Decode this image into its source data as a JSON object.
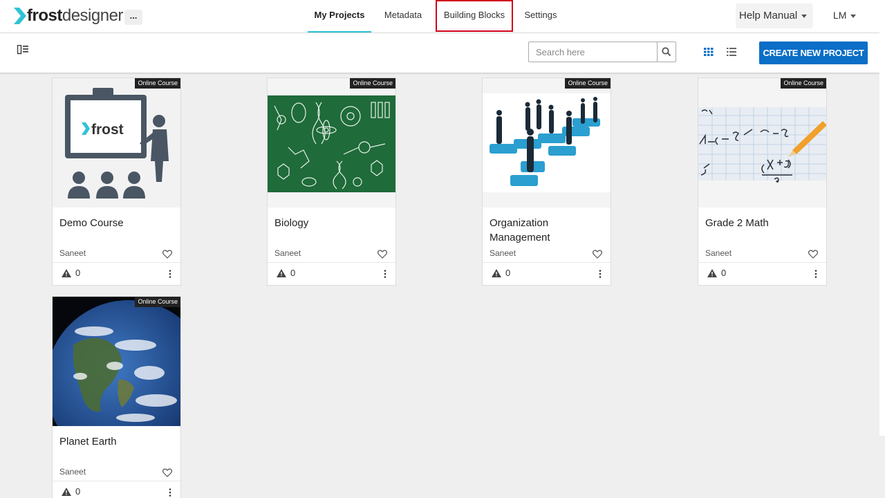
{
  "brand": {
    "bold": "frost",
    "light": "designer",
    "accent": "#2ec3d6"
  },
  "nav": {
    "more_label": "...",
    "tabs": [
      {
        "label": "My Projects",
        "active": true
      },
      {
        "label": "Metadata"
      },
      {
        "label": "Building Blocks",
        "highlighted": true
      },
      {
        "label": "Settings"
      }
    ],
    "help_label": "Help Manual",
    "user_initials": "LM"
  },
  "toolbar": {
    "search_placeholder": "Search here",
    "create_label": "CREATE NEW PROJECT",
    "create_color": "#0b6ec7"
  },
  "projects": [
    {
      "title": "Demo Course",
      "badge": "Online Course",
      "author": "Saneet",
      "warnings": "0",
      "thumb_text": "frost",
      "thumb": "frost-presenter"
    },
    {
      "title": "Biology",
      "badge": "Online Course",
      "author": "Saneet",
      "warnings": "0",
      "thumb": "chalkboard-doodles"
    },
    {
      "title": "Organization Management",
      "badge": "Online Course",
      "author": "Saneet",
      "warnings": "0",
      "thumb": "people-on-puzzle"
    },
    {
      "title": "Grade 2 Math",
      "badge": "Online Course",
      "author": "Saneet",
      "warnings": "0",
      "thumb": "math-paper-pencil"
    },
    {
      "title": "Planet Earth",
      "badge": "Online Course",
      "author": "Saneet",
      "warnings": "0",
      "thumb": "earth-from-space"
    }
  ]
}
